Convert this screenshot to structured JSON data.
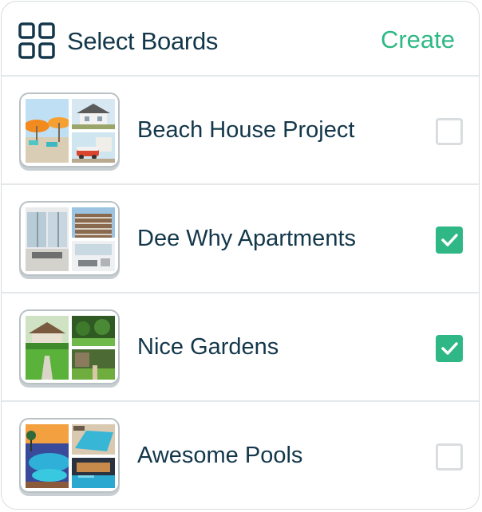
{
  "header": {
    "icon": "grid-icon",
    "title": "Select Boards",
    "create_label": "Create"
  },
  "colors": {
    "accent": "#2fb886",
    "text": "#13374a",
    "divider": "#e4e8ea"
  },
  "boards": [
    {
      "name": "Beach House Project",
      "checked": false
    },
    {
      "name": "Dee Why Apartments",
      "checked": true
    },
    {
      "name": "Nice Gardens",
      "checked": true
    },
    {
      "name": "Awesome Pools",
      "checked": false
    }
  ]
}
